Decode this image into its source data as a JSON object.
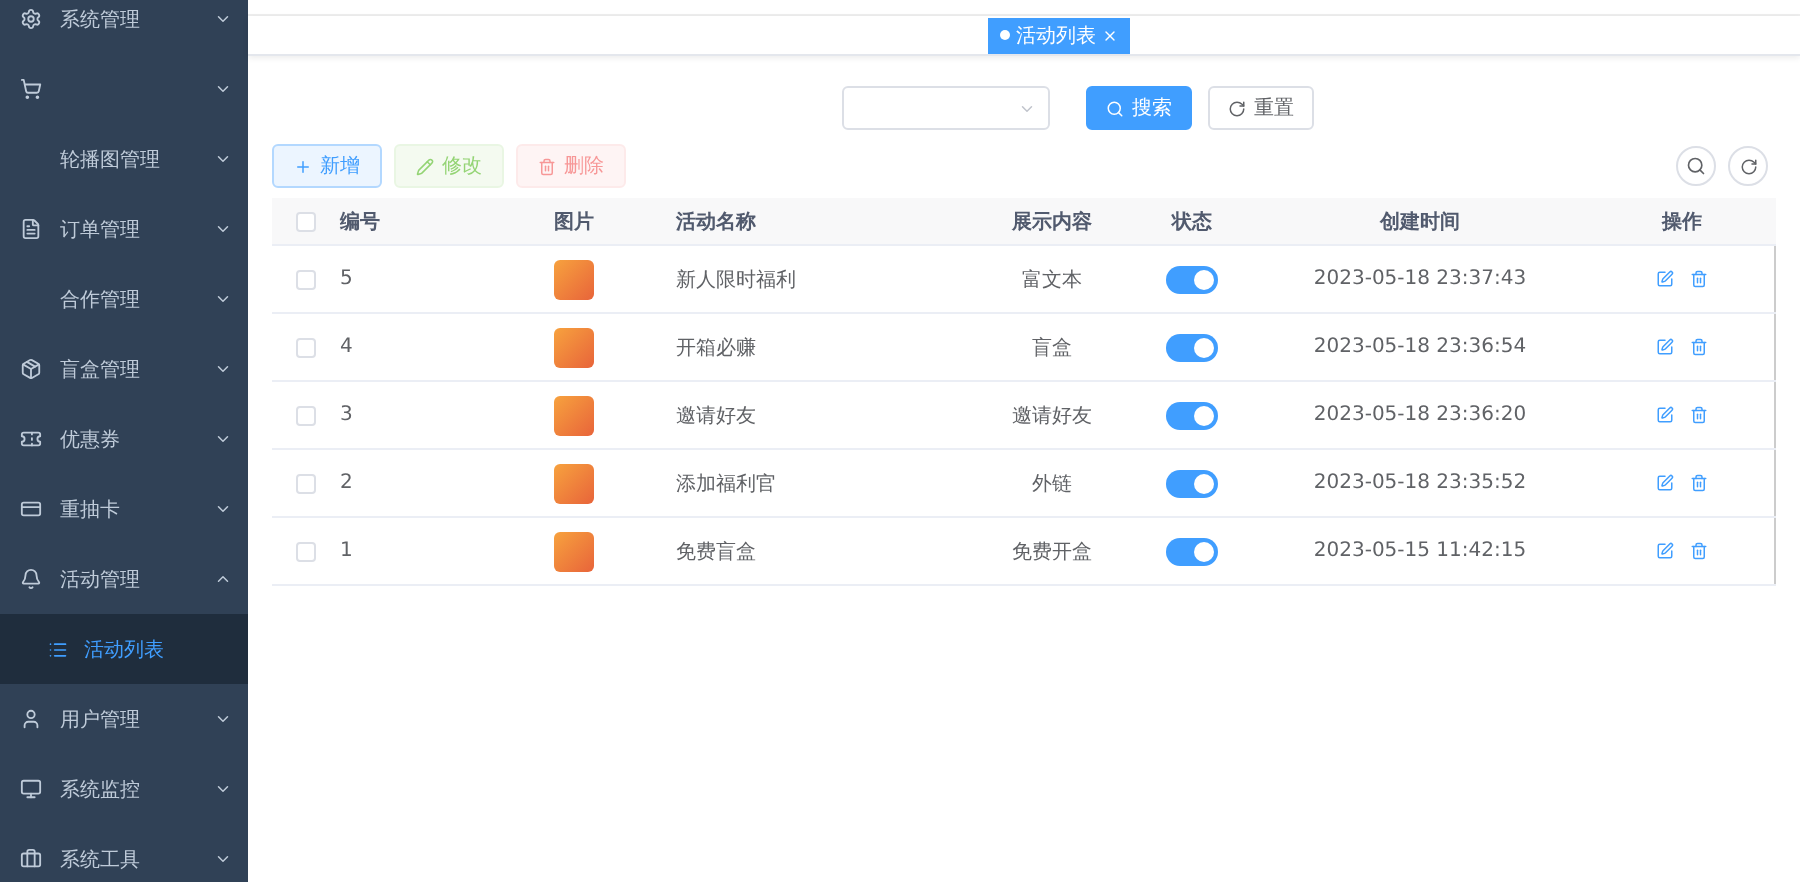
{
  "sidebar": {
    "items": [
      {
        "label": "系统管理",
        "expanded": false
      },
      {
        "expanded": false
      },
      {
        "label": "轮播图管理",
        "expanded": false
      },
      {
        "label": "订单管理",
        "expanded": false
      },
      {
        "label": "合作管理",
        "expanded": false
      },
      {
        "label": "盲盒管理",
        "expanded": false
      },
      {
        "label": "优惠券",
        "expanded": false
      },
      {
        "label": "重抽卡",
        "expanded": false
      },
      {
        "label": "活动管理",
        "expanded": true,
        "children": [
          {
            "label": "活动列表",
            "selected": true
          }
        ]
      },
      {
        "label": "用户管理",
        "expanded": false
      },
      {
        "label": "系统监控",
        "expanded": false
      },
      {
        "label": "系统工具",
        "expanded": false
      }
    ]
  },
  "tags": [
    {
      "label": "活动列表",
      "selected": true
    }
  ],
  "search": {
    "search_button": "搜索",
    "reset_button": "重置"
  },
  "toolbar": [
    {
      "kind": "add",
      "label": "新增",
      "disabled": false
    },
    {
      "kind": "edit",
      "label": "修改",
      "disabled": true
    },
    {
      "kind": "delete",
      "label": "删除",
      "disabled": true
    }
  ],
  "table": {
    "select_all_checked": false,
    "columns": [
      "编号",
      "图片",
      "活动名称",
      "展示内容",
      "状态",
      "创建时间",
      "操作"
    ],
    "rows": [
      {
        "checked": false,
        "id": "5",
        "name": "新人限时福利",
        "content": "富文本",
        "on": true,
        "created": "2023-05-18 23:37:43"
      },
      {
        "checked": false,
        "id": "4",
        "name": "开箱必赚",
        "content": "盲盒",
        "on": true,
        "created": "2023-05-18 23:36:54"
      },
      {
        "checked": false,
        "id": "3",
        "name": "邀请好友",
        "content": "邀请好友",
        "on": true,
        "created": "2023-05-18 23:36:20"
      },
      {
        "checked": false,
        "id": "2",
        "name": "添加福利官",
        "content": "外链",
        "on": true,
        "created": "2023-05-18 23:35:52"
      },
      {
        "checked": false,
        "id": "1",
        "name": "免费盲盒",
        "content": "免费开盒",
        "on": true,
        "created": "2023-05-15 11:42:15"
      }
    ]
  }
}
